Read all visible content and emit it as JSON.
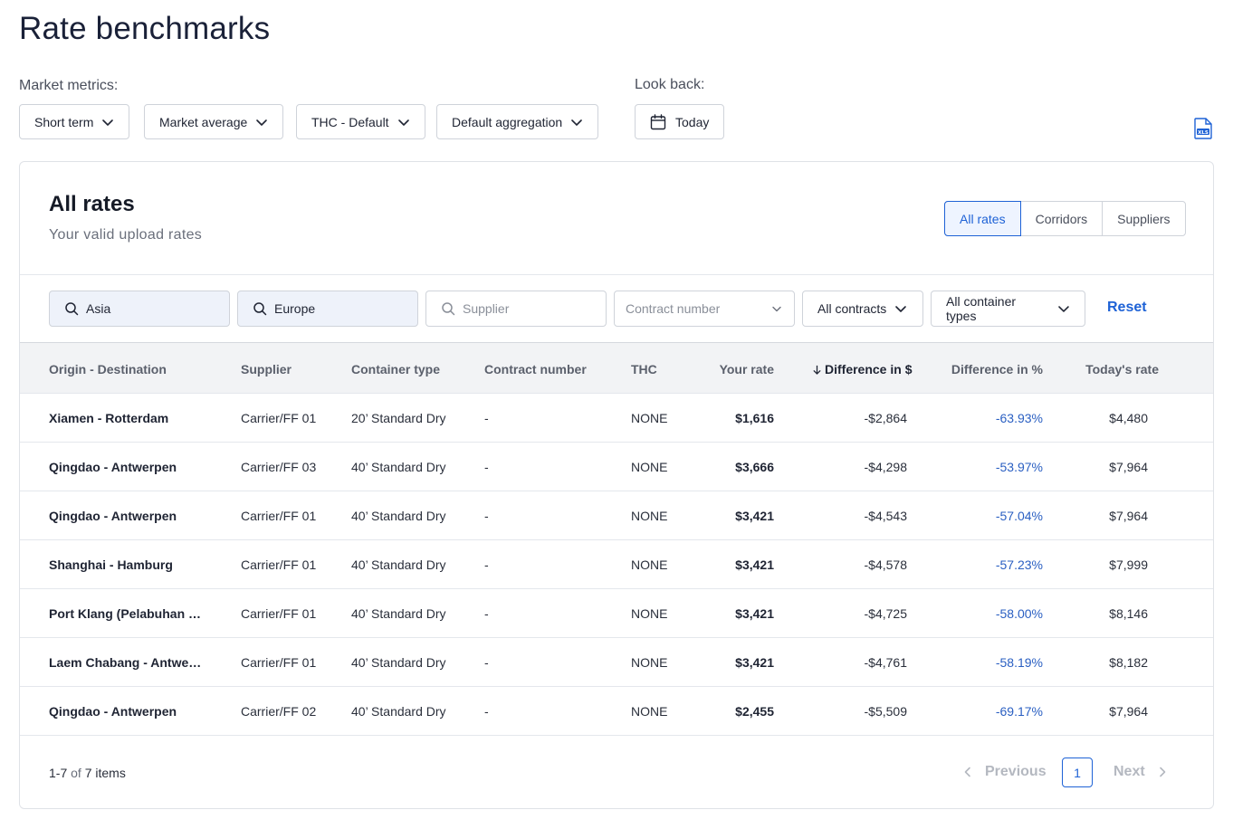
{
  "page": {
    "title": "Rate benchmarks"
  },
  "filters_top": {
    "market_metrics_label": "Market metrics:",
    "look_back_label": "Look back:",
    "term": "Short term",
    "market": "Market average",
    "thc": "THC - Default",
    "aggregation": "Default aggregation",
    "look_back_value": "Today"
  },
  "card": {
    "title": "All rates",
    "subtitle": "Your valid upload rates",
    "tabs": [
      "All rates",
      "Corridors",
      "Suppliers"
    ],
    "active_tab": "All rates"
  },
  "search": {
    "origin_value": "Asia",
    "destination_value": "Europe",
    "supplier_placeholder": "Supplier",
    "contract_placeholder": "Contract number",
    "contracts": "All contracts",
    "container_types": "All container types",
    "reset_label": "Reset"
  },
  "table": {
    "columns": [
      "Origin - Destination",
      "Supplier",
      "Container type",
      "Contract number",
      "THC",
      "Your rate",
      "Difference in $",
      "Difference in %",
      "Today's rate"
    ],
    "rows": [
      {
        "od": "Xiamen - Rotterdam",
        "supplier": "Carrier/FF 01",
        "container": "20’ Standard Dry",
        "contract": "-",
        "thc": "NONE",
        "rate": "$1,616",
        "diff": "-$2,864",
        "pct": "-63.93%",
        "today": "$4,480"
      },
      {
        "od": "Qingdao - Antwerpen",
        "supplier": "Carrier/FF 03",
        "container": "40’ Standard Dry",
        "contract": "-",
        "thc": "NONE",
        "rate": "$3,666",
        "diff": "-$4,298",
        "pct": "-53.97%",
        "today": "$7,964"
      },
      {
        "od": "Qingdao - Antwerpen",
        "supplier": "Carrier/FF 01",
        "container": "40’ Standard Dry",
        "contract": "-",
        "thc": "NONE",
        "rate": "$3,421",
        "diff": "-$4,543",
        "pct": "-57.04%",
        "today": "$7,964"
      },
      {
        "od": "Shanghai - Hamburg",
        "supplier": "Carrier/FF 01",
        "container": "40’ Standard Dry",
        "contract": "-",
        "thc": "NONE",
        "rate": "$3,421",
        "diff": "-$4,578",
        "pct": "-57.23%",
        "today": "$7,999"
      },
      {
        "od": "Port Klang (Pelabuhan K...",
        "supplier": "Carrier/FF 01",
        "container": "40’ Standard Dry",
        "contract": "-",
        "thc": "NONE",
        "rate": "$3,421",
        "diff": "-$4,725",
        "pct": "-58.00%",
        "today": "$8,146"
      },
      {
        "od": "Laem Chabang - Antwer...",
        "supplier": "Carrier/FF 01",
        "container": "40’ Standard Dry",
        "contract": "-",
        "thc": "NONE",
        "rate": "$3,421",
        "diff": "-$4,761",
        "pct": "-58.19%",
        "today": "$8,182"
      },
      {
        "od": "Qingdao - Antwerpen",
        "supplier": "Carrier/FF 02",
        "container": "40’ Standard Dry",
        "contract": "-",
        "thc": "NONE",
        "rate": "$2,455",
        "diff": "-$5,509",
        "pct": "-69.17%",
        "today": "$7,964"
      }
    ]
  },
  "pagination": {
    "range": "1-7",
    "of": "of",
    "total": "7 items",
    "previous": "Previous",
    "next": "Next",
    "current_page": "1"
  },
  "colors": {
    "accent": "#1e62d6",
    "header_bg": "#f2f3f5",
    "filled_input_bg": "#eef2fa"
  }
}
